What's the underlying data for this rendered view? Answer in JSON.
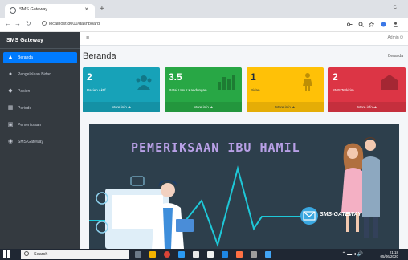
{
  "browser": {
    "tab_title": "SMS Gateway",
    "tab_close": "×",
    "new_tab": "+",
    "window_controls": "C",
    "url": "localhost:8000/dashboard"
  },
  "sidebar": {
    "brand": "SMS Gateway",
    "items": [
      {
        "label": "Beranda",
        "icon": "dashboard-icon"
      },
      {
        "label": "Pengelolaan Bidan",
        "icon": "user-icon"
      },
      {
        "label": "Pasien",
        "icon": "users-icon"
      },
      {
        "label": "Periode",
        "icon": "table-icon"
      },
      {
        "label": "Pemeriksaan",
        "icon": "monitor-icon"
      },
      {
        "label": "SMS Gateway",
        "icon": "user-group-icon"
      }
    ],
    "active_color": "#007bff"
  },
  "topbar": {
    "menu": "≡",
    "user": "Admin"
  },
  "page": {
    "title": "Beranda",
    "breadcrumb": "Beranda"
  },
  "boxes": [
    {
      "number": "2",
      "label": "Pasien Aktif",
      "footer": "More info ➔",
      "color": "#17a2b8"
    },
    {
      "number": "3.5",
      "label": "Rata² Umur Kandungan",
      "footer": "More info ➔",
      "color": "#28a745"
    },
    {
      "number": "1",
      "label": "Bidan",
      "footer": "More info ➔",
      "color": "#ffc107"
    },
    {
      "number": "2",
      "label": "SMS Terkirim",
      "footer": "More info ➔",
      "color": "#dc3545"
    }
  ],
  "banner": {
    "title": "PEMERIKSAAN IBU HAMIL",
    "brand": "SMS-GATEWAY"
  },
  "taskbar": {
    "search": "Search",
    "time": "21:18",
    "date": "05/06/2020"
  }
}
